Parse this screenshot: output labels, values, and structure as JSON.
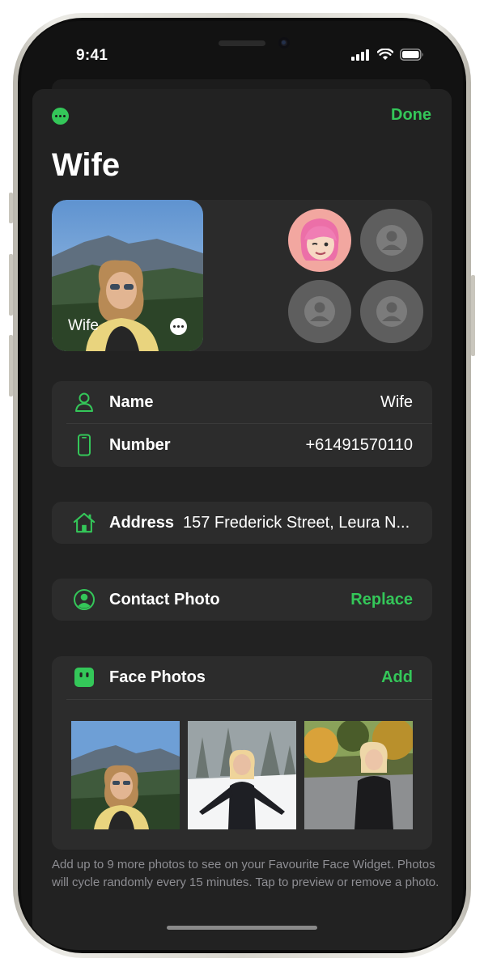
{
  "status_bar": {
    "time": "9:41"
  },
  "header": {
    "done_label": "Done",
    "title": "Wife"
  },
  "widget": {
    "photo_label": "Wife",
    "avatars": [
      "memoji-avatar",
      "empty-avatar",
      "empty-avatar",
      "empty-avatar"
    ]
  },
  "contact": {
    "name_label": "Name",
    "name_value": "Wife",
    "number_label": "Number",
    "number_value": "+61491570110"
  },
  "address": {
    "label": "Address",
    "value": "157 Frederick Street, Leura N..."
  },
  "contact_photo": {
    "label": "Contact Photo",
    "action": "Replace"
  },
  "face_photos": {
    "label": "Face Photos",
    "action": "Add",
    "count": 3
  },
  "footnote": "Add up to 9 more photos to see on your Favourite Face Widget. Photos will cycle randomly every 15 minutes. Tap to preview or remove a photo.",
  "colors": {
    "accent": "#34c759",
    "background": "#121212",
    "card": "#2c2c2c"
  }
}
